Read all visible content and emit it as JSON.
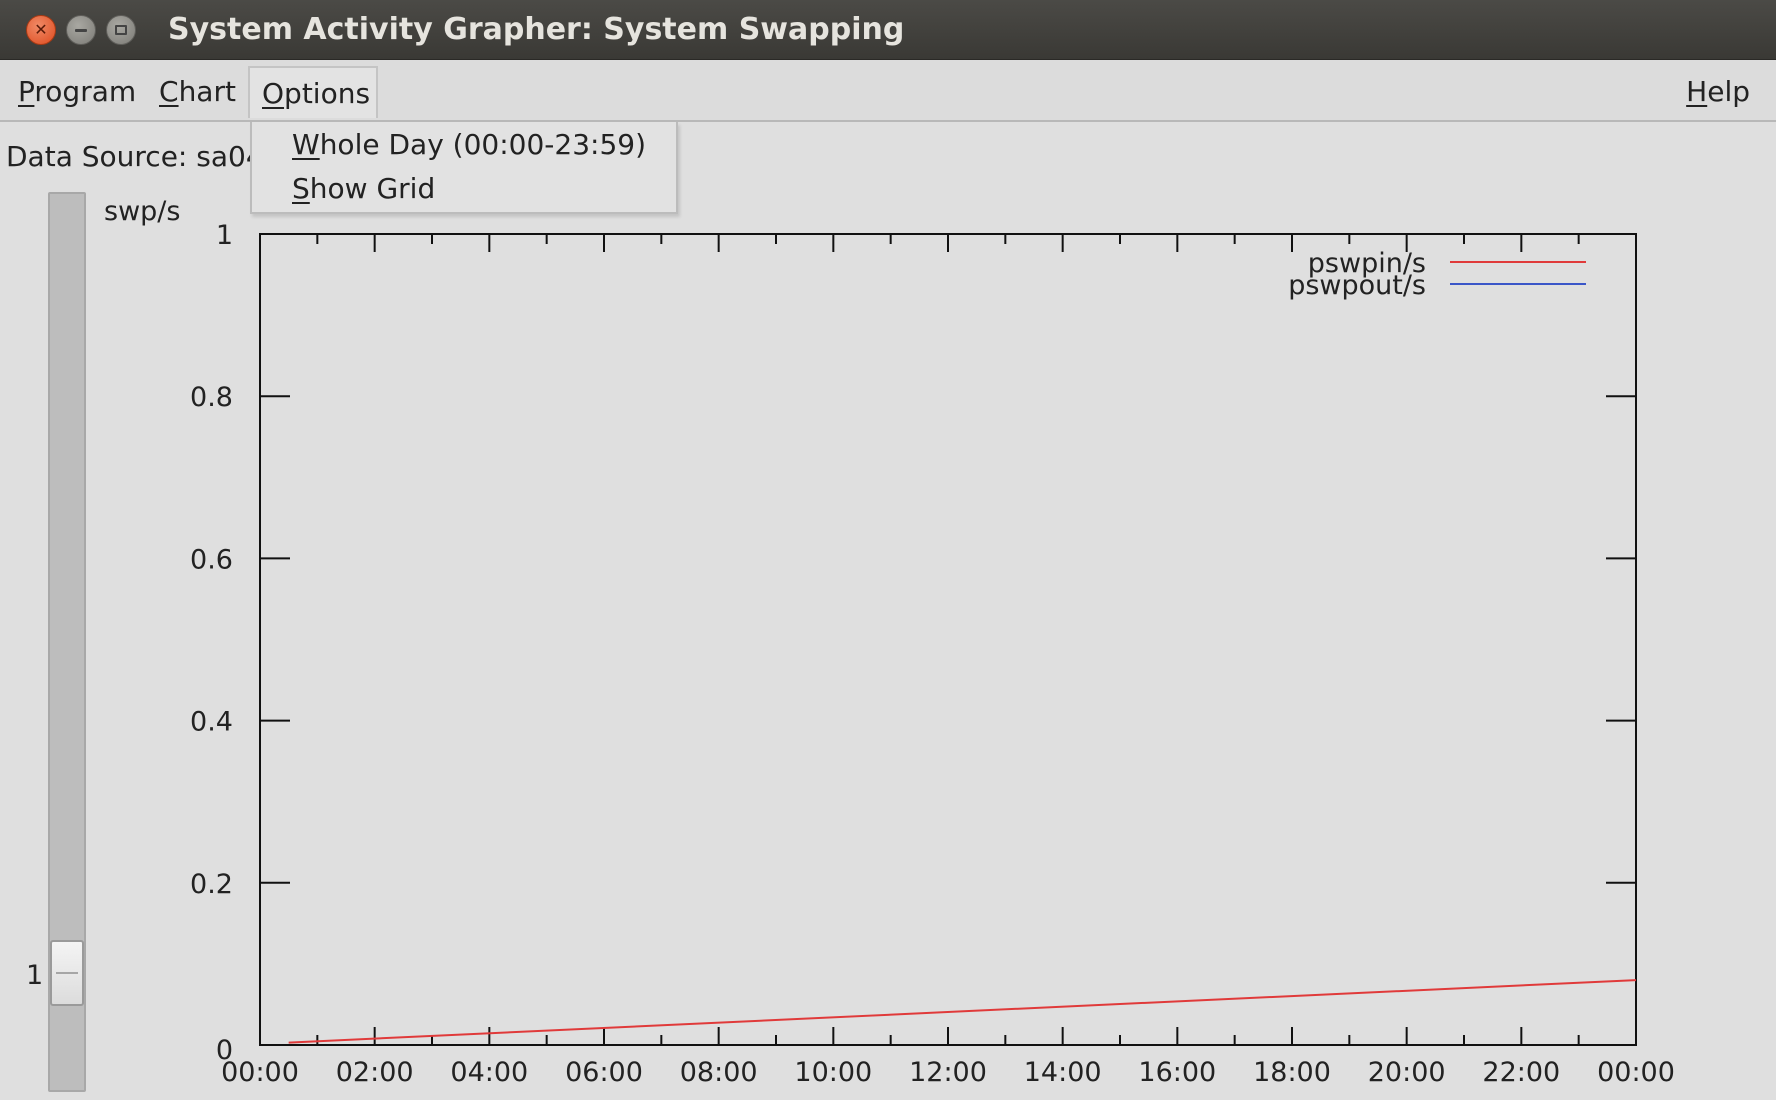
{
  "window": {
    "title": "System Activity Grapher: System Swapping"
  },
  "menubar": {
    "program": {
      "pre": "",
      "key": "P",
      "rest": "rogram"
    },
    "chart": {
      "pre": "",
      "key": "C",
      "rest": "hart"
    },
    "options": {
      "pre": "",
      "key": "O",
      "rest": "ptions"
    },
    "help": {
      "pre": "",
      "key": "H",
      "rest": "elp"
    }
  },
  "options_menu": {
    "whole_day": {
      "key": "W",
      "rest": "hole Day (00:00-23:59)"
    },
    "show_grid": {
      "key": "S",
      "rest": "how Grid"
    }
  },
  "data_source": "Data Source: sa04",
  "slider": {
    "value": "1"
  },
  "chart_data": {
    "type": "line",
    "ylabel": "swp/s",
    "ylim": [
      0,
      1
    ],
    "yticks": [
      "0",
      "0.2",
      "0.4",
      "0.6",
      "0.8",
      "1"
    ],
    "xticks": [
      "00:00",
      "02:00",
      "04:00",
      "06:00",
      "08:00",
      "10:00",
      "12:00",
      "14:00",
      "16:00",
      "18:00",
      "20:00",
      "22:00",
      "00:00"
    ],
    "xlim_hours": [
      0,
      24
    ],
    "grid": false,
    "legend_position": "top-right",
    "series": [
      {
        "name": "pswpin/s",
        "color": "#e03a3a",
        "x": [
          0.5,
          24
        ],
        "y": [
          0.003,
          0.08
        ]
      },
      {
        "name": "pswpout/s",
        "color": "#3a56c8",
        "x": [],
        "y": []
      }
    ]
  }
}
